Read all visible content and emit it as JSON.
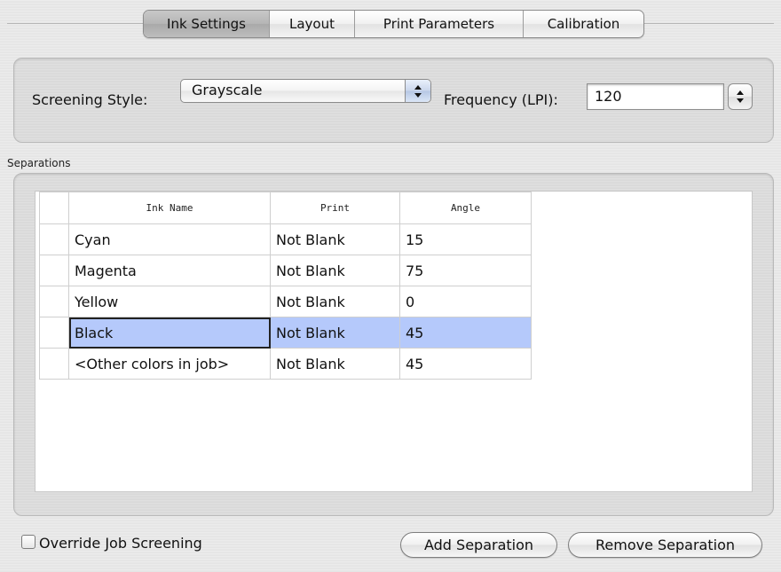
{
  "tabs": [
    {
      "label": "Ink Settings",
      "active": true
    },
    {
      "label": "Layout",
      "active": false
    },
    {
      "label": "Print Parameters",
      "active": false
    },
    {
      "label": "Calibration",
      "active": false
    }
  ],
  "screening": {
    "style_label": "Screening Style:",
    "style_value": "Grayscale",
    "frequency_label": "Frequency (LPI):",
    "frequency_value": "120"
  },
  "separations": {
    "group_label": "Separations",
    "columns": [
      "Ink Name",
      "Print",
      "Angle"
    ],
    "rows": [
      {
        "ink": "Cyan",
        "print": "Not Blank",
        "angle": "15"
      },
      {
        "ink": "Magenta",
        "print": "Not Blank",
        "angle": "75"
      },
      {
        "ink": "Yellow",
        "print": "Not Blank",
        "angle": "0"
      },
      {
        "ink": "Black",
        "print": "Not Blank",
        "angle": "45",
        "selected": true
      },
      {
        "ink": "<Other colors in job>",
        "print": "Not Blank",
        "angle": "45"
      }
    ]
  },
  "footer": {
    "override_label": "Override Job Screening",
    "override_checked": false,
    "add_label": "Add Separation",
    "remove_label": "Remove Separation"
  },
  "colors": {
    "selection": "#b5c9fb",
    "active_tab": "#b5b5b5"
  },
  "icons": {
    "popup_arrows": "up-down-arrows-icon",
    "stepper": "up-down-arrows-icon"
  }
}
